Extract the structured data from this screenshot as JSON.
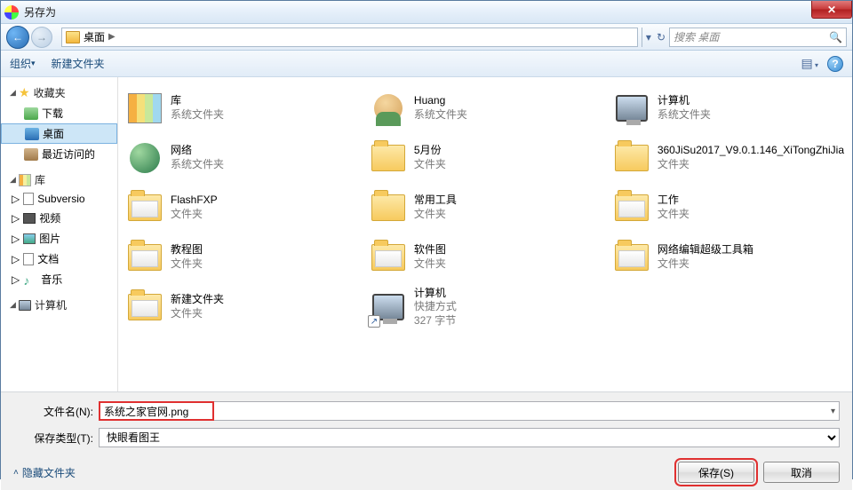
{
  "title": "另存为",
  "breadcrumb": {
    "root_icon": "desktop",
    "segments": [
      "桌面"
    ]
  },
  "nav": {
    "refresh_dropdown": "▾"
  },
  "search": {
    "placeholder": "搜索 桌面"
  },
  "toolbar": {
    "organize": "组织",
    "new_folder": "新建文件夹",
    "view_tip": "视图",
    "help": "?"
  },
  "sidebar": {
    "groups": [
      {
        "label": "收藏夹",
        "icon": "star",
        "expanded": true,
        "items": [
          {
            "label": "下载",
            "icon": "dl"
          },
          {
            "label": "桌面",
            "icon": "desktop",
            "selected": true
          },
          {
            "label": "最近访问的",
            "icon": "recent"
          }
        ]
      },
      {
        "label": "库",
        "icon": "lib",
        "expanded": true,
        "items": [
          {
            "label": "Subversio",
            "icon": "doc",
            "expandable": true
          },
          {
            "label": "视频",
            "icon": "video",
            "expandable": true
          },
          {
            "label": "图片",
            "icon": "pic",
            "expandable": true
          },
          {
            "label": "文档",
            "icon": "doc",
            "expandable": true
          },
          {
            "label": "音乐",
            "icon": "music",
            "expandable": true
          }
        ]
      },
      {
        "label": "计算机",
        "icon": "computer",
        "expanded": true,
        "items": []
      }
    ]
  },
  "files": [
    {
      "name": "库",
      "sub": "系统文件夹",
      "icon": "lib"
    },
    {
      "name": "Huang",
      "sub": "系统文件夹",
      "icon": "user"
    },
    {
      "name": "计算机",
      "sub": "系统文件夹",
      "icon": "computer"
    },
    {
      "name": "网络",
      "sub": "系统文件夹",
      "icon": "net"
    },
    {
      "name": "5月份",
      "sub": "文件夹",
      "icon": "folder"
    },
    {
      "name": "360JiSu2017_V9.0.1.146_XiTongZhiJia",
      "sub": "文件夹",
      "icon": "folder"
    },
    {
      "name": "FlashFXP",
      "sub": "文件夹",
      "icon": "folder-open"
    },
    {
      "name": "常用工具",
      "sub": "文件夹",
      "icon": "folder"
    },
    {
      "name": "工作",
      "sub": "文件夹",
      "icon": "folder-open"
    },
    {
      "name": "教程图",
      "sub": "文件夹",
      "icon": "folder-open"
    },
    {
      "name": "软件图",
      "sub": "文件夹",
      "icon": "folder-open"
    },
    {
      "name": "网络编辑超级工具箱",
      "sub": "文件夹",
      "icon": "folder-open"
    },
    {
      "name": "新建文件夹",
      "sub": "文件夹",
      "icon": "folder-open"
    },
    {
      "name": "计算机",
      "sub": "快捷方式",
      "sub2": "327 字节",
      "icon": "computer",
      "shortcut": true
    }
  ],
  "form": {
    "filename_label": "文件名(N):",
    "filename_value": "系统之家官网.png",
    "type_label": "保存类型(T):",
    "type_value": "快眼看图王"
  },
  "footer": {
    "hide_folders": "隐藏文件夹",
    "save": "保存(S)",
    "cancel": "取消"
  }
}
